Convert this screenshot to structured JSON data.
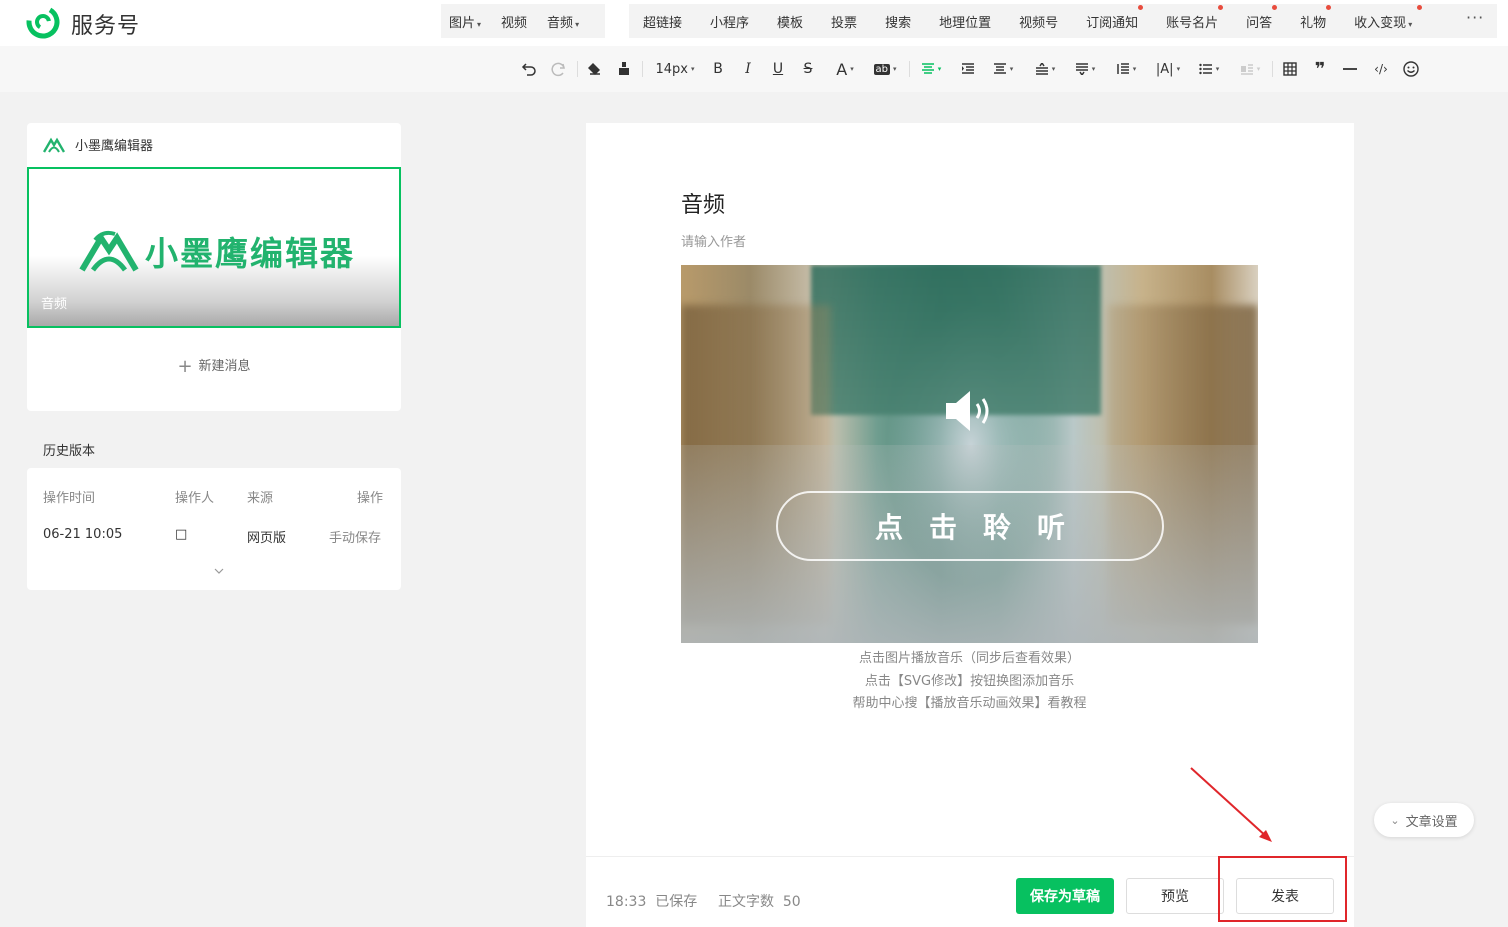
{
  "header": {
    "brand": "服务号",
    "insert_group1": [
      {
        "label": "图片",
        "caret": true
      },
      {
        "label": "视频",
        "caret": false
      },
      {
        "label": "音频",
        "caret": true
      }
    ],
    "insert_group2": [
      {
        "label": "超链接",
        "caret": false,
        "dot": false
      },
      {
        "label": "小程序",
        "caret": false,
        "dot": false
      },
      {
        "label": "模板",
        "caret": false,
        "dot": false
      },
      {
        "label": "投票",
        "caret": false,
        "dot": false
      },
      {
        "label": "搜索",
        "caret": false,
        "dot": false
      },
      {
        "label": "地理位置",
        "caret": false,
        "dot": false
      },
      {
        "label": "视频号",
        "caret": false,
        "dot": false
      },
      {
        "label": "订阅通知",
        "caret": false,
        "dot": true
      },
      {
        "label": "账号名片",
        "caret": false,
        "dot": true
      },
      {
        "label": "问答",
        "caret": false,
        "dot": true
      },
      {
        "label": "礼物",
        "caret": false,
        "dot": true
      },
      {
        "label": "收入变现",
        "caret": true,
        "dot": true
      }
    ],
    "more": "···"
  },
  "toolbar": {
    "font_size": "14px",
    "bold": "B",
    "italic": "I",
    "underline": "U",
    "strike": "S",
    "font_color": "A",
    "bg_color": "ab"
  },
  "left": {
    "editor_name": "小墨鹰编辑器",
    "cover_brand": "小墨鹰编辑器",
    "cover_title": "音频",
    "new_message": "新建消息",
    "history_title": "历史版本",
    "history_headers": [
      "操作时间",
      "操作人",
      "来源",
      "操作"
    ],
    "history_rows": [
      {
        "time": "06-21 10:05",
        "operator": "□",
        "source": "网页版",
        "action": "手动保存"
      }
    ]
  },
  "editor": {
    "title": "音频",
    "author_placeholder": "请输入作者",
    "listen_button": "点击聆听",
    "captions": [
      "点击图片播放音乐（同步后查看效果）",
      "点击【SVG修改】按钮换图添加音乐",
      "帮助中心搜【播放音乐动画效果】看教程"
    ]
  },
  "footer": {
    "save_status": "18:33  已保存",
    "word_count": "正文字数  50",
    "save_draft": "保存为草稿",
    "preview": "预览",
    "publish": "发表"
  },
  "side": {
    "article_settings": "文章设置"
  },
  "colors": {
    "accent": "#07c160",
    "highlight": "#e0262b",
    "notify_dot": "#e84c3d"
  }
}
